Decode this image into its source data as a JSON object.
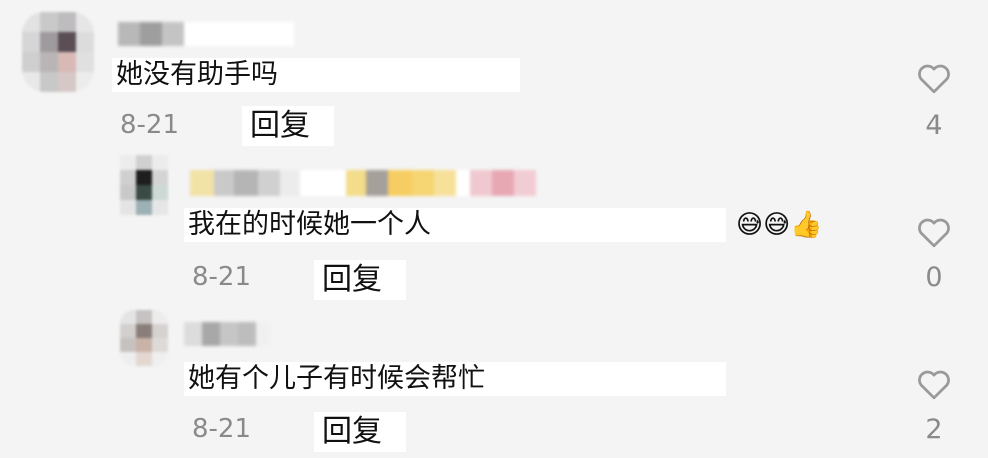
{
  "comments": [
    {
      "text": "她没有助手吗",
      "date": "8-21",
      "reply_label": "回复",
      "likes": "4"
    },
    {
      "text": "我在的时候她一个人",
      "emojis": "😅😅👍",
      "date": "8-21",
      "reply_label": "回复",
      "likes": "0"
    },
    {
      "text": "她有个儿子有时候会帮忙",
      "date": "8-21",
      "reply_label": "回复",
      "likes": "2"
    }
  ],
  "icons": {
    "like": "heart-outline-icon"
  },
  "colors": {
    "background": "#f4f4f4",
    "meta_gray": "#8a8a8a",
    "heart_stroke": "#9a9a9a"
  }
}
